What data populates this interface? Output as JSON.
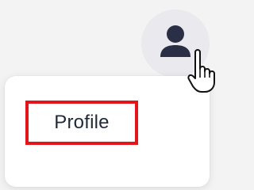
{
  "header": {
    "avatar_icon": "user-icon",
    "cursor_icon": "hand-pointer-icon"
  },
  "menu": {
    "items": [
      {
        "label": "Profile",
        "highlighted": true
      }
    ]
  },
  "colors": {
    "highlight_border": "#e4141b",
    "icon": "#2b2f45",
    "avatar_bg": "#e9e9ee",
    "page_bg": "#f3f3f4"
  }
}
